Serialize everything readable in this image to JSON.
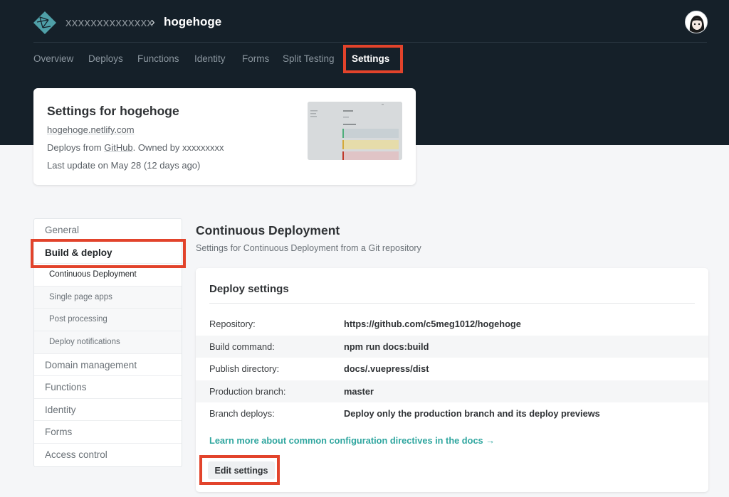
{
  "header": {
    "team_name": "xxxxxxxxxxxxxx",
    "separator": "›",
    "site_name": "hogehoge",
    "logo_icon": "netlify-logo-icon",
    "avatar_icon": "user-avatar-icon"
  },
  "tabs": [
    {
      "label": "Overview"
    },
    {
      "label": "Deploys"
    },
    {
      "label": "Functions"
    },
    {
      "label": "Identity"
    },
    {
      "label": "Forms"
    },
    {
      "label": "Split Testing"
    },
    {
      "label": "Settings",
      "active": true
    }
  ],
  "site_card": {
    "title": "Settings for hogehoge",
    "url": "hogehoge.netlify.com",
    "deploys_prefix": "Deploys from ",
    "deploys_source": "GitHub",
    "deploys_owner": ". Owned by xxxxxxxxx",
    "last_update": "Last update on May 28 (12 days ago)"
  },
  "sidebar": {
    "items": [
      {
        "label": "General"
      },
      {
        "label": "Build & deploy",
        "active": true
      },
      {
        "label": "Continuous Deployment",
        "sub": true,
        "active": true
      },
      {
        "label": "Single page apps",
        "sub": true
      },
      {
        "label": "Post processing",
        "sub": true
      },
      {
        "label": "Deploy notifications",
        "sub": true
      },
      {
        "label": "Domain management"
      },
      {
        "label": "Functions"
      },
      {
        "label": "Identity"
      },
      {
        "label": "Forms"
      },
      {
        "label": "Access control"
      }
    ]
  },
  "section": {
    "title": "Continuous Deployment",
    "description": "Settings for Continuous Deployment from a Git repository"
  },
  "deploy_settings": {
    "title": "Deploy settings",
    "rows": [
      {
        "label": "Repository:",
        "value": "https://github.com/c5meg1012/hogehoge"
      },
      {
        "label": "Build command:",
        "value": "npm run docs:build"
      },
      {
        "label": "Publish directory:",
        "value": "docs/.vuepress/dist"
      },
      {
        "label": "Production branch:",
        "value": "master"
      },
      {
        "label": "Branch deploys:",
        "value": "Deploy only the production branch and its deploy previews"
      }
    ],
    "learn_more": "Learn more about common configuration directives in the docs →",
    "edit_button": "Edit settings"
  },
  "colors": {
    "header_bg": "#152029",
    "highlight": "#e2432b",
    "link": "#2fa69f"
  }
}
